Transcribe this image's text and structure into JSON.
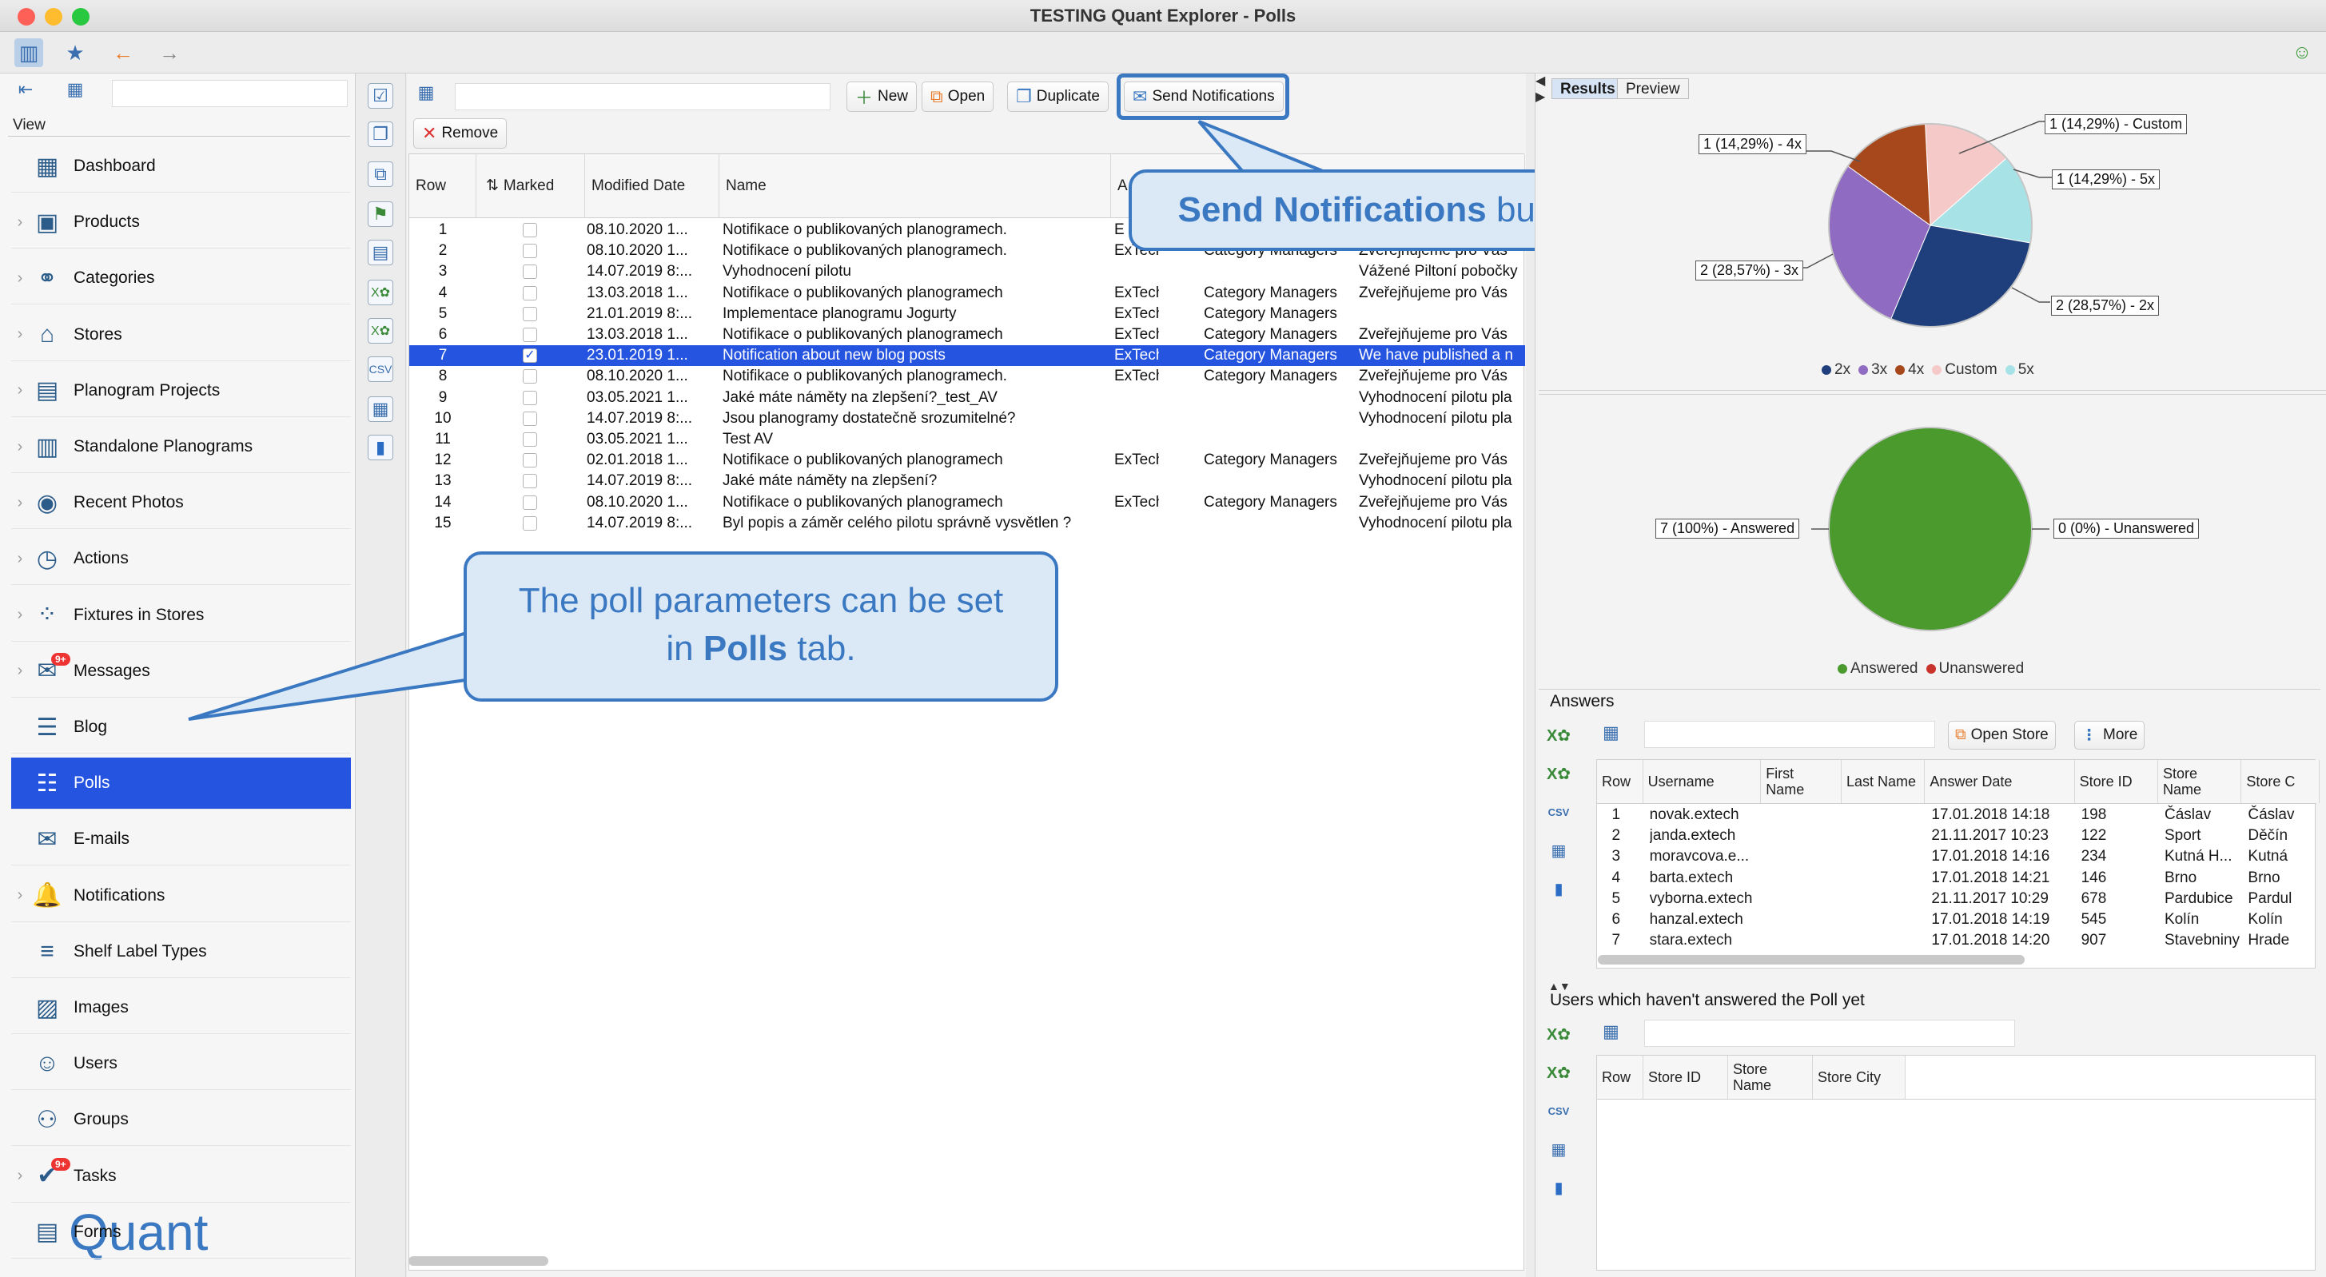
{
  "window": {
    "title": "TESTING Quant Explorer - Polls"
  },
  "sidebar": {
    "view_label": "View",
    "items": [
      {
        "label": "Dashboard",
        "icon": "dashboard-icon",
        "glyph": "▦",
        "chev": ""
      },
      {
        "label": "Products",
        "icon": "products-icon",
        "glyph": "▣",
        "chev": "›"
      },
      {
        "label": "Categories",
        "icon": "categories-icon",
        "glyph": "⚭",
        "chev": "›"
      },
      {
        "label": "Stores",
        "icon": "stores-icon",
        "glyph": "⌂",
        "chev": "›"
      },
      {
        "label": "Planogram Projects",
        "icon": "planogram-projects-icon",
        "glyph": "▤",
        "chev": "›"
      },
      {
        "label": "Standalone Planograms",
        "icon": "standalone-planograms-icon",
        "glyph": "▥",
        "chev": "›"
      },
      {
        "label": "Recent Photos",
        "icon": "camera-icon",
        "glyph": "◉",
        "chev": "›"
      },
      {
        "label": "Actions",
        "icon": "clock-icon",
        "glyph": "◷",
        "chev": "›"
      },
      {
        "label": "Fixtures in Stores",
        "icon": "fixtures-icon",
        "glyph": "⁘",
        "chev": "›"
      },
      {
        "label": "Messages",
        "icon": "messages-icon",
        "glyph": "✉",
        "chev": "›",
        "badge": "9+"
      },
      {
        "label": "Blog",
        "icon": "blog-icon",
        "glyph": "☰",
        "chev": ""
      },
      {
        "label": "Polls",
        "icon": "polls-icon",
        "glyph": "☷",
        "chev": "",
        "active": true
      },
      {
        "label": "E-mails",
        "icon": "email-icon",
        "glyph": "✉",
        "chev": ""
      },
      {
        "label": "Notifications",
        "icon": "bell-icon",
        "glyph": "🔔",
        "chev": "›"
      },
      {
        "label": "Shelf Label Types",
        "icon": "shelf-label-icon",
        "glyph": "≡",
        "chev": ""
      },
      {
        "label": "Images",
        "icon": "images-icon",
        "glyph": "▨",
        "chev": ""
      },
      {
        "label": "Users",
        "icon": "user-icon",
        "glyph": "☺",
        "chev": ""
      },
      {
        "label": "Groups",
        "icon": "groups-icon",
        "glyph": "⚇",
        "chev": ""
      },
      {
        "label": "Tasks",
        "icon": "tasks-icon",
        "glyph": "✔",
        "chev": "›",
        "badge": "9+"
      },
      {
        "label": "Forms",
        "icon": "forms-icon",
        "glyph": "▤",
        "chev": ""
      }
    ],
    "logo_text": "Quant"
  },
  "toolbar": {
    "new_label": "New",
    "open_label": "Open",
    "duplicate_label": "Duplicate",
    "send_label": "Send Notifications",
    "remove_label": "Remove"
  },
  "polls_table": {
    "headers": {
      "row": "Row",
      "marked": "Marked",
      "modified": "Modified Date",
      "name": "Name",
      "a": "A"
    },
    "rows": [
      {
        "row": "1",
        "marked": false,
        "date": "08.10.2020 1...",
        "name": "Notifikace o publikovaných planogramech.",
        "author": "E",
        "group": "",
        "text": ""
      },
      {
        "row": "2",
        "marked": false,
        "date": "08.10.2020 1...",
        "name": "Notifikace o publikovaných planogramech.",
        "author": "ExTech",
        "group": "Category Managers",
        "text": "Zveřejňujeme pro Vás"
      },
      {
        "row": "3",
        "marked": false,
        "date": "14.07.2019 8:...",
        "name": "Vyhodnocení pilotu",
        "author": "",
        "group": "",
        "text": "Vážené Piltoní pobočky"
      },
      {
        "row": "4",
        "marked": false,
        "date": "13.03.2018 1...",
        "name": "Notifikace o publikovaných planogramech",
        "author": "ExTech",
        "group": "Category Managers",
        "text": "Zveřejňujeme pro Vás"
      },
      {
        "row": "5",
        "marked": false,
        "date": "21.01.2019 8:...",
        "name": "Implementace planogramu Jogurty",
        "author": "ExTech",
        "group": "Category Managers",
        "text": ""
      },
      {
        "row": "6",
        "marked": false,
        "date": "13.03.2018 1...",
        "name": "Notifikace o publikovaných planogramech",
        "author": "ExTech",
        "group": "Category Managers",
        "text": "Zveřejňujeme pro Vás"
      },
      {
        "row": "7",
        "marked": true,
        "date": "23.01.2019 1...",
        "name": "Notification about new blog posts",
        "author": "ExTech",
        "group": "Category Managers",
        "text": "We have published a n",
        "selected": true
      },
      {
        "row": "8",
        "marked": false,
        "date": "08.10.2020 1...",
        "name": "Notifikace o publikovaných planogramech.",
        "author": "ExTech",
        "group": "Category Managers",
        "text": "Zveřejňujeme pro Vás"
      },
      {
        "row": "9",
        "marked": false,
        "date": "03.05.2021 1...",
        "name": "Jaké máte náměty na zlepšení?_test_AV",
        "author": "",
        "group": "",
        "text": "Vyhodnocení pilotu pla"
      },
      {
        "row": "10",
        "marked": false,
        "date": "14.07.2019 8:...",
        "name": "Jsou planogramy dostatečně srozumitelné?",
        "author": "",
        "group": "",
        "text": "Vyhodnocení pilotu pla"
      },
      {
        "row": "11",
        "marked": false,
        "date": "03.05.2021 1...",
        "name": "Test AV",
        "author": "",
        "group": "",
        "text": ""
      },
      {
        "row": "12",
        "marked": false,
        "date": "02.01.2018 1...",
        "name": "Notifikace o publikovaných planogramech",
        "author": "ExTech",
        "group": "Category Managers",
        "text": "Zveřejňujeme pro Vás"
      },
      {
        "row": "13",
        "marked": false,
        "date": "14.07.2019 8:...",
        "name": "Jaké máte náměty na zlepšení?",
        "author": "",
        "group": "",
        "text": "Vyhodnocení pilotu pla"
      },
      {
        "row": "14",
        "marked": false,
        "date": "08.10.2020 1...",
        "name": "Notifikace o publikovaných planogramech",
        "author": "ExTech",
        "group": "Category Managers",
        "text": "Zveřejňujeme pro Vás"
      },
      {
        "row": "15",
        "marked": false,
        "date": "14.07.2019 8:...",
        "name": "Byl popis a záměr celého pilotu správně vysvětlen ?",
        "author": "",
        "group": "",
        "text": "Vyhodnocení pilotu pla"
      }
    ]
  },
  "callouts": {
    "send": {
      "bold": "Send Notifications",
      "rest": " button."
    },
    "polls": {
      "line1": "The poll parameters can be set",
      "line2_pre": "in ",
      "line2_bold": "Polls",
      "line2_post": " tab."
    }
  },
  "right_panel": {
    "tabs": [
      "Results",
      "Preview"
    ],
    "pie1": {
      "slices": [
        {
          "label": "1 (14,29%) - Custom",
          "name": "Custom",
          "value": 1,
          "color": "#f6c9c9"
        },
        {
          "label": "1 (14,29%) - 5x",
          "name": "5x",
          "value": 1,
          "color": "#a7e3e6"
        },
        {
          "label": "2 (28,57%) - 2x",
          "name": "2x",
          "value": 2,
          "color": "#1f3f7c"
        },
        {
          "label": "2 (28,57%) - 3x",
          "name": "3x",
          "value": 2,
          "color": "#8f6bc2"
        },
        {
          "label": "1 (14,29%) - 4x",
          "name": "4x",
          "value": 1,
          "color": "#a7481c"
        }
      ],
      "legend": [
        {
          "name": "2x",
          "color": "#1f3f7c"
        },
        {
          "name": "3x",
          "color": "#8f6bc2"
        },
        {
          "name": "4x",
          "color": "#a7481c"
        },
        {
          "name": "Custom",
          "color": "#f6c9c9"
        },
        {
          "name": "5x",
          "color": "#a7e3e6"
        }
      ]
    },
    "pie2": {
      "label_answered": "7 (100%) - Answered",
      "label_unanswered": "0 (0%) - Unanswered",
      "legend": [
        {
          "name": "Answered",
          "color": "#4a9a2e"
        },
        {
          "name": "Unanswered",
          "color": "#c8332b"
        }
      ]
    },
    "answers": {
      "title": "Answers",
      "open_store": "Open Store",
      "more": "More",
      "headers": [
        "Row",
        "Username",
        "First Name",
        "Last Name",
        "Answer Date",
        "Store ID",
        "Store Name",
        "Store C"
      ],
      "rows": [
        [
          "1",
          "novak.extech",
          "",
          "",
          "17.01.2018 14:18",
          "198",
          "Čáslav",
          "Čáslav"
        ],
        [
          "2",
          "janda.extech",
          "",
          "",
          "21.11.2017 10:23",
          "122",
          "Sport",
          "Děčín"
        ],
        [
          "3",
          "moravcova.e...",
          "",
          "",
          "17.01.2018 14:16",
          "234",
          "Kutná H...",
          "Kutná"
        ],
        [
          "4",
          "barta.extech",
          "",
          "",
          "17.01.2018 14:21",
          "146",
          "Brno",
          "Brno"
        ],
        [
          "5",
          "vyborna.extech",
          "",
          "",
          "21.11.2017 10:29",
          "678",
          "Pardubice",
          "Pardul"
        ],
        [
          "6",
          "hanzal.extech",
          "",
          "",
          "17.01.2018 14:19",
          "545",
          "Kolín",
          "Kolín"
        ],
        [
          "7",
          "stara.extech",
          "",
          "",
          "17.01.2018 14:20",
          "907",
          "Stavebniny",
          "Hrade"
        ]
      ]
    },
    "unanswered": {
      "title": "Users which haven't answered the Poll yet",
      "headers": [
        "Row",
        "Store ID",
        "Store Name",
        "Store City"
      ]
    }
  }
}
